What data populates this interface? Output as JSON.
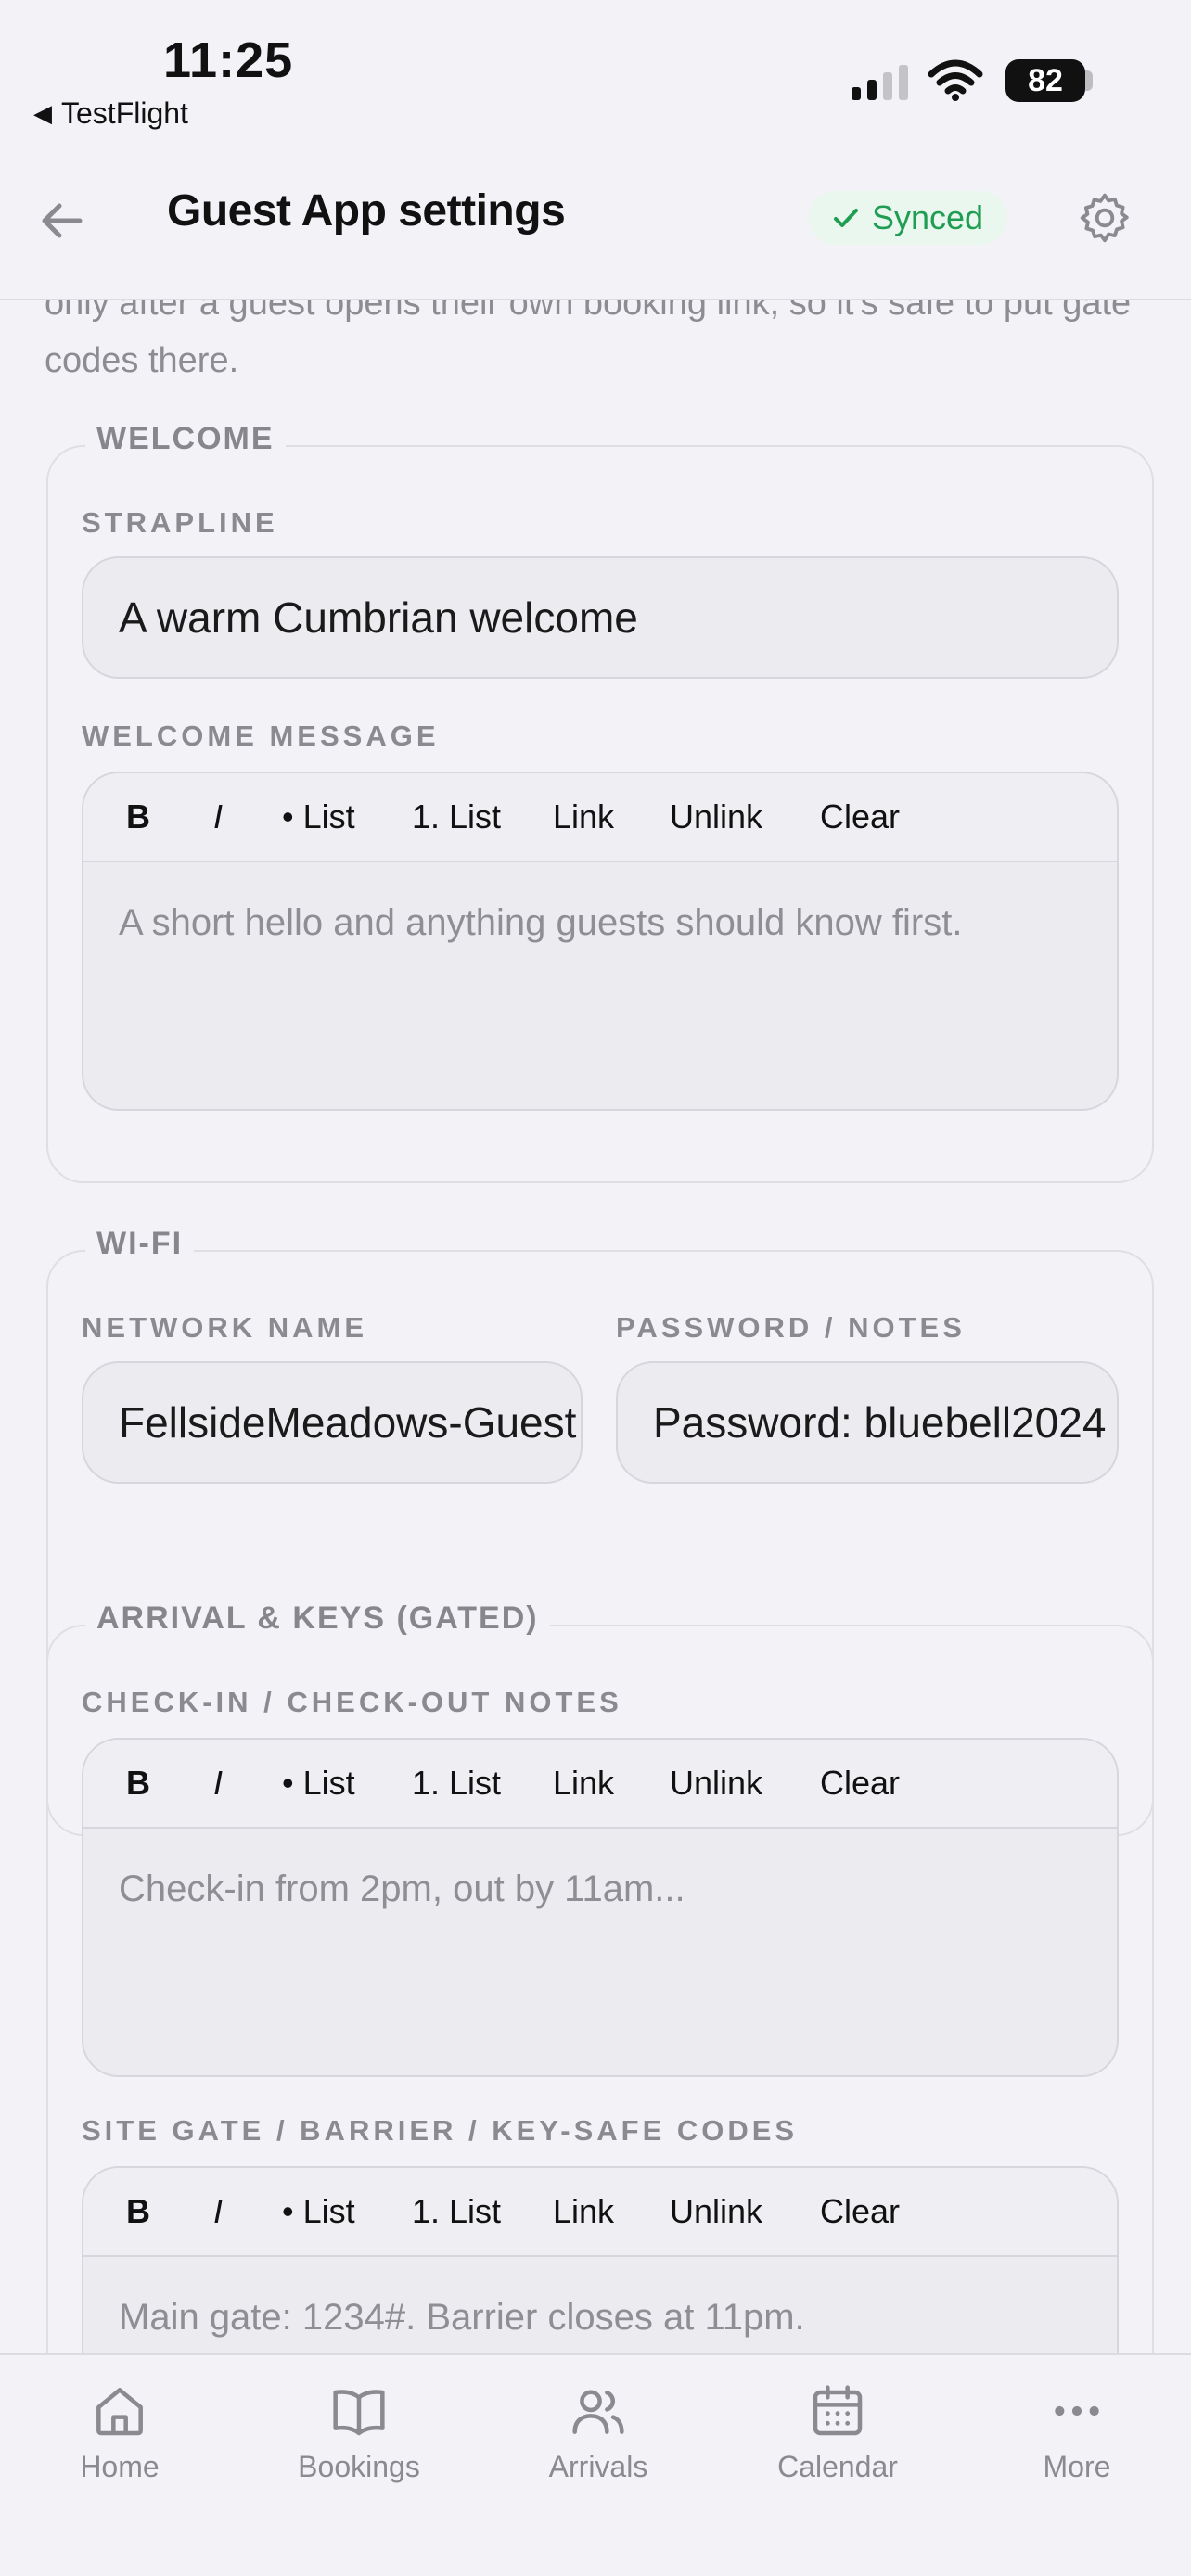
{
  "status_bar": {
    "time": "11:25",
    "back_app": "TestFlight",
    "battery": "82"
  },
  "header": {
    "title": "Guest App settings",
    "sync_status": "Synced"
  },
  "intro_text": "only after a guest opens their own booking link, so it's safe to put gate codes there.",
  "editor_toolbar": [
    "B",
    "I",
    "• List",
    "1. List",
    "Link",
    "Unlink",
    "Clear"
  ],
  "welcome": {
    "legend": "WELCOME",
    "strapline_label": "STRAPLINE",
    "strapline_value": "A warm Cumbrian welcome",
    "message_label": "WELCOME MESSAGE",
    "message_placeholder": "A short hello and anything guests should know first."
  },
  "wifi": {
    "legend": "WI-FI",
    "network_label": "NETWORK NAME",
    "network_value": "FellsideMeadows-Guest",
    "password_label": "PASSWORD / NOTES",
    "password_value": "Password: bluebell2024"
  },
  "arrival": {
    "legend": "ARRIVAL & KEYS (GATED)",
    "notes_label": "CHECK-IN / CHECK-OUT NOTES",
    "notes_placeholder": "Check-in from 2pm, out by 11am...",
    "codes_label": "SITE GATE / BARRIER / KEY-SAFE CODES",
    "codes_placeholder": "Main gate: 1234#. Barrier closes at 11pm."
  },
  "tabs": [
    {
      "label": "Home",
      "icon": "home-icon"
    },
    {
      "label": "Bookings",
      "icon": "book-icon"
    },
    {
      "label": "Arrivals",
      "icon": "users-icon"
    },
    {
      "label": "Calendar",
      "icon": "calendar-icon"
    },
    {
      "label": "More",
      "icon": "more-icon"
    }
  ]
}
